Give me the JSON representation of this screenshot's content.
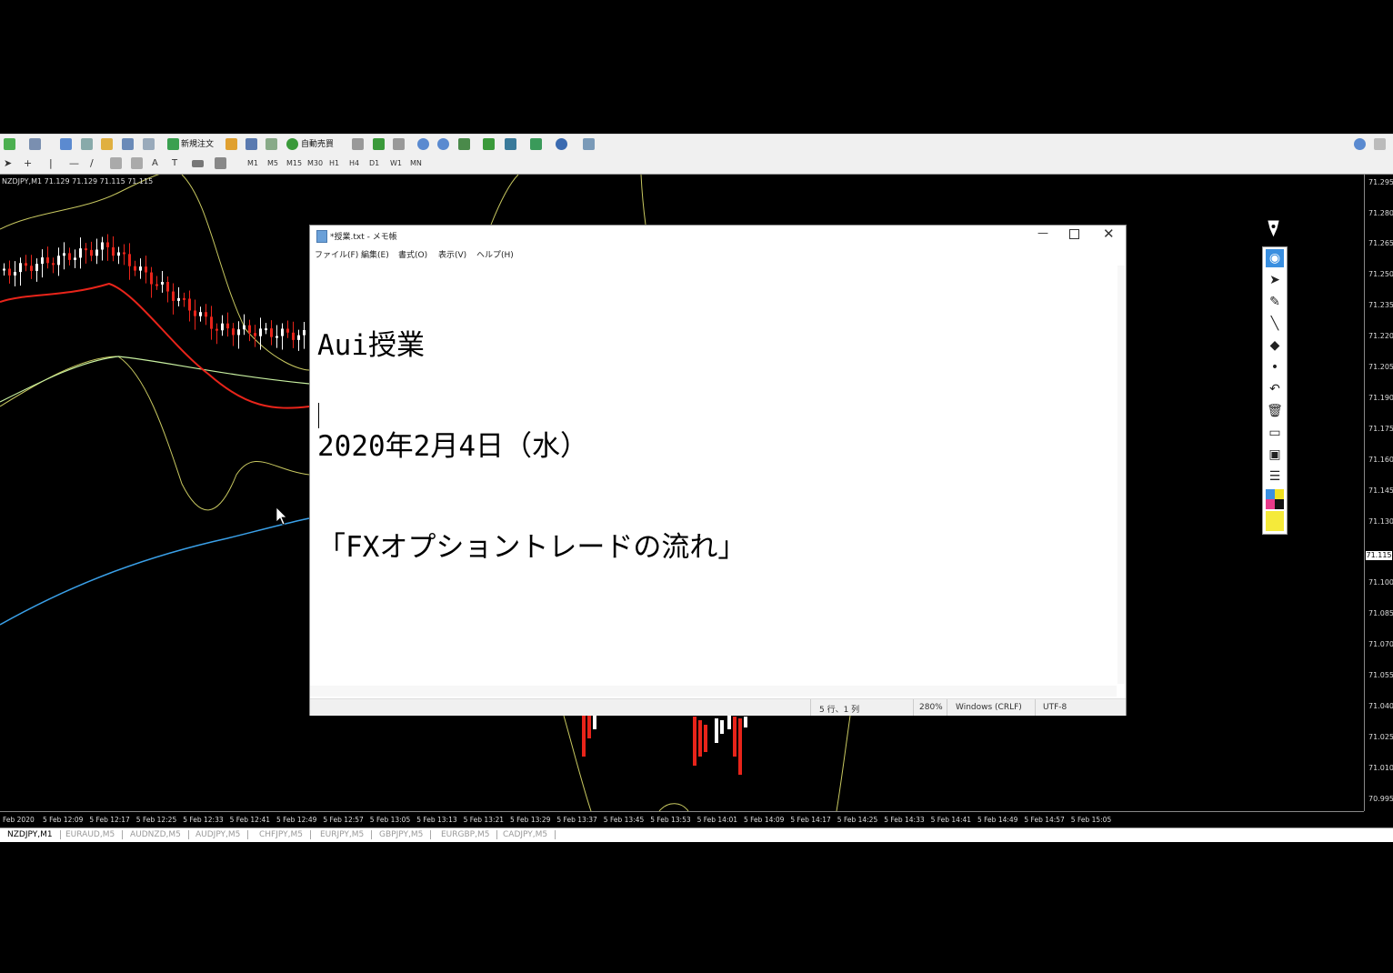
{
  "toolbar1": {
    "new_order_label": "新規注文",
    "auto_trade_label": "自動売買"
  },
  "toolbar2": {
    "timeframes": [
      "M1",
      "M5",
      "M15",
      "M30",
      "H1",
      "H4",
      "D1",
      "W1",
      "MN"
    ]
  },
  "chart": {
    "header": "NZDJPY,M1  71.129 71.129 71.115 71.115",
    "current_price": "71.115",
    "price_labels": [
      "71.295",
      "71.280",
      "71.265",
      "71.250",
      "71.235",
      "71.220",
      "71.205",
      "71.190",
      "71.175",
      "71.160",
      "71.145",
      "71.130",
      "71.100",
      "71.085",
      "71.070",
      "71.055",
      "71.040",
      "71.025",
      "71.010",
      "70.995"
    ],
    "time_labels": [
      "Feb 2020",
      "5 Feb 12:09",
      "5 Feb 12:17",
      "5 Feb 12:25",
      "5 Feb 12:33",
      "5 Feb 12:41",
      "5 Feb 12:49",
      "5 Feb 12:57",
      "5 Feb 13:05",
      "5 Feb 13:13",
      "5 Feb 13:21",
      "5 Feb 13:29",
      "5 Feb 13:37",
      "5 Feb 13:45",
      "5 Feb 13:53",
      "5 Feb 14:01",
      "5 Feb 14:09",
      "5 Feb 14:17",
      "5 Feb 14:25",
      "5 Feb 14:33",
      "5 Feb 14:41",
      "5 Feb 14:49",
      "5 Feb 14:57",
      "5 Feb 15:05"
    ],
    "colors": {
      "bull": "#ffffff",
      "bear": "#e8241a",
      "band": "#c8c860",
      "ma_mid": "#c8f0a0",
      "ma_fast": "#e8241a",
      "ma_slow": "#3aa0e8"
    }
  },
  "symbol_tabs": [
    "NZDJPY,M1",
    "EURAUD,M5",
    "AUDNZD,M5",
    "AUDJPY,M5",
    "CHFJPY,M5",
    "EURJPY,M5",
    "GBPJPY,M5",
    "EURGBP,M5",
    "CADJPY,M5"
  ],
  "notepad": {
    "title": "*授業.txt - メモ帳",
    "menu": [
      "ファイル(F)",
      "編集(E)",
      "書式(O)",
      "表示(V)",
      "ヘルプ(H)"
    ],
    "content_lines": [
      "Aui授業",
      "2020年2月4日（水）",
      "「FXオプショントレードの流れ」"
    ],
    "status": {
      "position": "5 行、1 列",
      "zoom": "280%",
      "line_ending": "Windows (CRLF)",
      "encoding": "UTF-8"
    }
  },
  "draw_palette": {
    "icons": [
      "pen-icon",
      "eye-icon",
      "cursor-icon",
      "marker-icon",
      "line-icon",
      "eraser-icon",
      "dot-icon",
      "undo-icon",
      "trash-icon",
      "board-icon",
      "camera-icon",
      "clipboard-icon"
    ],
    "swatch_colors": [
      "#3a8fe0",
      "#f0e020",
      "#e83a8a",
      "#111111",
      "#f5ea3a"
    ]
  }
}
